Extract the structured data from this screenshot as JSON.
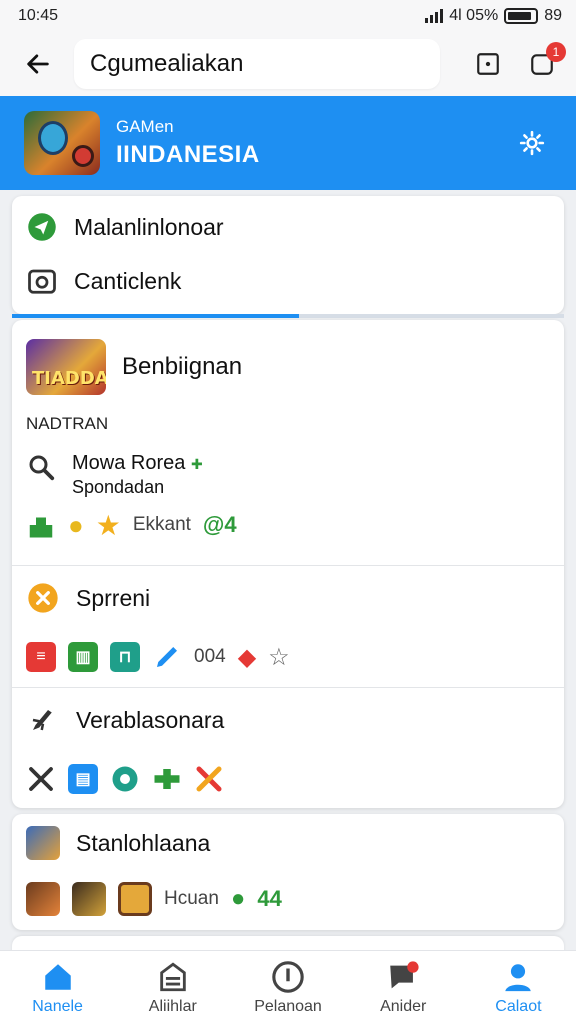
{
  "status_bar": {
    "time": "10:45",
    "right_text": "4l 05%",
    "battery": "89",
    "battery_level": 0.89
  },
  "search": {
    "value": "Cgumealiakan"
  },
  "top_actions": {
    "notification_count": "1"
  },
  "hero": {
    "subtitle": "GAMen",
    "title": "IINDANESIA"
  },
  "menu": [
    {
      "label": "Malanlinlonoar",
      "icon": "send-icon",
      "color": "#2e9a3a"
    },
    {
      "label": "Canticlenk",
      "icon": "camera-icon",
      "color": "#333333"
    }
  ],
  "progress_value": 0.52,
  "game": {
    "icon_text": "TIADDAL",
    "name": "Benbiignan"
  },
  "section_label": "NADTRAN",
  "search_result": {
    "title": "Mowa Rorea",
    "subtitle": "Spondadan"
  },
  "row1": {
    "text": "Ekkant",
    "trail": "@4"
  },
  "section_b": {
    "label": "Sprreni",
    "text": "004"
  },
  "section_c": {
    "label": "Verablasonara"
  },
  "bottom_card": {
    "label": "Stanlohlaana",
    "text": "Hcuan",
    "count": "44"
  },
  "nav": [
    {
      "label": "Nanele",
      "icon": "home-icon",
      "active": true
    },
    {
      "label": "Aliihlar",
      "icon": "store-icon",
      "active": false
    },
    {
      "label": "Pelanoan",
      "icon": "circle-icon",
      "active": false
    },
    {
      "label": "Anider",
      "icon": "chat-icon",
      "active": false
    },
    {
      "label": "Calaot",
      "icon": "profile-icon",
      "active": true
    }
  ],
  "colors": {
    "accent": "#1e8ff2",
    "badge": "#e53935",
    "green": "#2e9a3a"
  }
}
